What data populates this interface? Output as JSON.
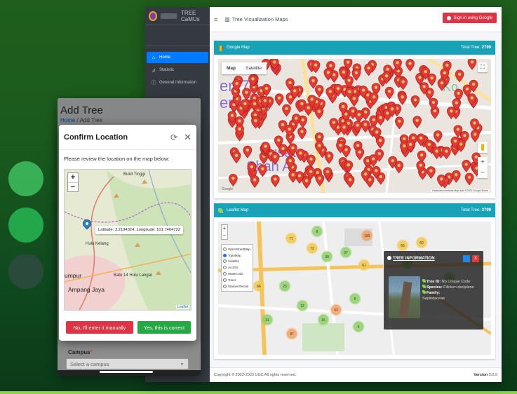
{
  "desktop": {
    "brand": "TREE CaMUs",
    "topbar_title": "Tree Visualization Maps",
    "signin_label": "Sign in using Google",
    "nav": [
      {
        "label": "Home",
        "icon": "home-icon",
        "active": true
      },
      {
        "label": "Statistic",
        "icon": "chart-icon",
        "active": false
      },
      {
        "label": "General Information",
        "icon": "info-icon",
        "active": false
      }
    ],
    "google_card": {
      "title": "Google Map",
      "total_label": "Total Tree:",
      "total_value": "2799",
      "map_toggle": [
        "Map",
        "Satellite"
      ],
      "map_text": [
        "en 7",
        "erprise)",
        "Pusat",
        "Shah Al",
        "Ko"
      ],
      "attribution": "Keyboard shortcuts   Map data ©2023 Google   Terms",
      "logo": "Google"
    },
    "leaflet_card": {
      "title": "Leaflet Map",
      "total_label": "Total Tree:",
      "total_value": "2799",
      "layers": [
        "OpenStreetMap",
        "TopoMap",
        "Satellite",
        "ArcGIS",
        "Watercolor",
        "Toner",
        "StamenTerrain"
      ],
      "selected_layer": "TopoMap",
      "clusters": [
        "77",
        "6",
        "72",
        "126",
        "66",
        "60",
        "39",
        "37",
        "61",
        "23",
        "66",
        "93",
        "12",
        "5",
        "16",
        "31",
        "5",
        "97",
        "3",
        "6"
      ],
      "popup": {
        "title": "TREE INFORMATION",
        "close": "X",
        "tree_id_label": "Tree ID:",
        "tree_id_value": "No Unique Code",
        "species_label": "Species:",
        "species_value": "Filicium decipiens",
        "family_label": "Family:",
        "family_value": "Sapindaceae"
      }
    },
    "footer": {
      "copyright": "Copyright © 2022-2023 UGC All rights reserved.",
      "version_label": "Version",
      "version_value": "3.2.0"
    }
  },
  "mobile": {
    "page_title": "Add Tree",
    "breadcrumb_home": "Home",
    "breadcrumb_sep": "/",
    "breadcrumb_current": "Add Tree",
    "campus_label": "Campus",
    "campus_required": "*",
    "campus_placeholder": "Select a campus",
    "modal": {
      "title": "Confirm Location",
      "message": "Please review the location on the map below:",
      "latlng": "Latitude: 3.2194324, Longitude: 101.7404722",
      "map_labels": [
        "Bukit Tinggi",
        "Hulu Kelang",
        "Ampang Jaya",
        "Batu 14 Hulu Langat",
        "umpur"
      ],
      "attribution": "Leaflet",
      "btn_no": "No, I'll enter it manually",
      "btn_yes": "Yes, this is correct"
    }
  },
  "colors": {
    "primary": "#007bff",
    "info": "#17a2b8",
    "danger": "#dc3545",
    "success": "#28a745",
    "sidebar": "#343a40"
  }
}
